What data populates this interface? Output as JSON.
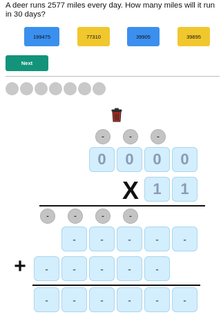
{
  "question": "A deer runs 2577 miles every day. How many miles will it run in 30 days?",
  "options": [
    {
      "label": "199475",
      "color": "#3b8fef"
    },
    {
      "label": "77310",
      "color": "#f1c72e"
    },
    {
      "label": "39905",
      "color": "#3b8fef"
    },
    {
      "label": "39895",
      "color": "#f1c72e"
    }
  ],
  "next_label": "Next",
  "progress": {
    "total": 7,
    "completed": 0
  },
  "trash_icon": "trash-icon",
  "work": {
    "top_carries": [
      "-",
      "-",
      "-"
    ],
    "multiplicand": [
      "0",
      "0",
      "0",
      "0"
    ],
    "operator_multiply": "X",
    "multiplier": [
      "1",
      "1"
    ],
    "mid_carries": [
      "-",
      "-",
      "-",
      "-"
    ],
    "partial_row_1": [
      "-",
      "-",
      "-",
      "-",
      "-"
    ],
    "operator_add": "+",
    "partial_row_2": [
      "-",
      "-",
      "-",
      "-",
      "-"
    ],
    "result": [
      "-",
      "-",
      "-",
      "-",
      "-",
      "-"
    ]
  }
}
